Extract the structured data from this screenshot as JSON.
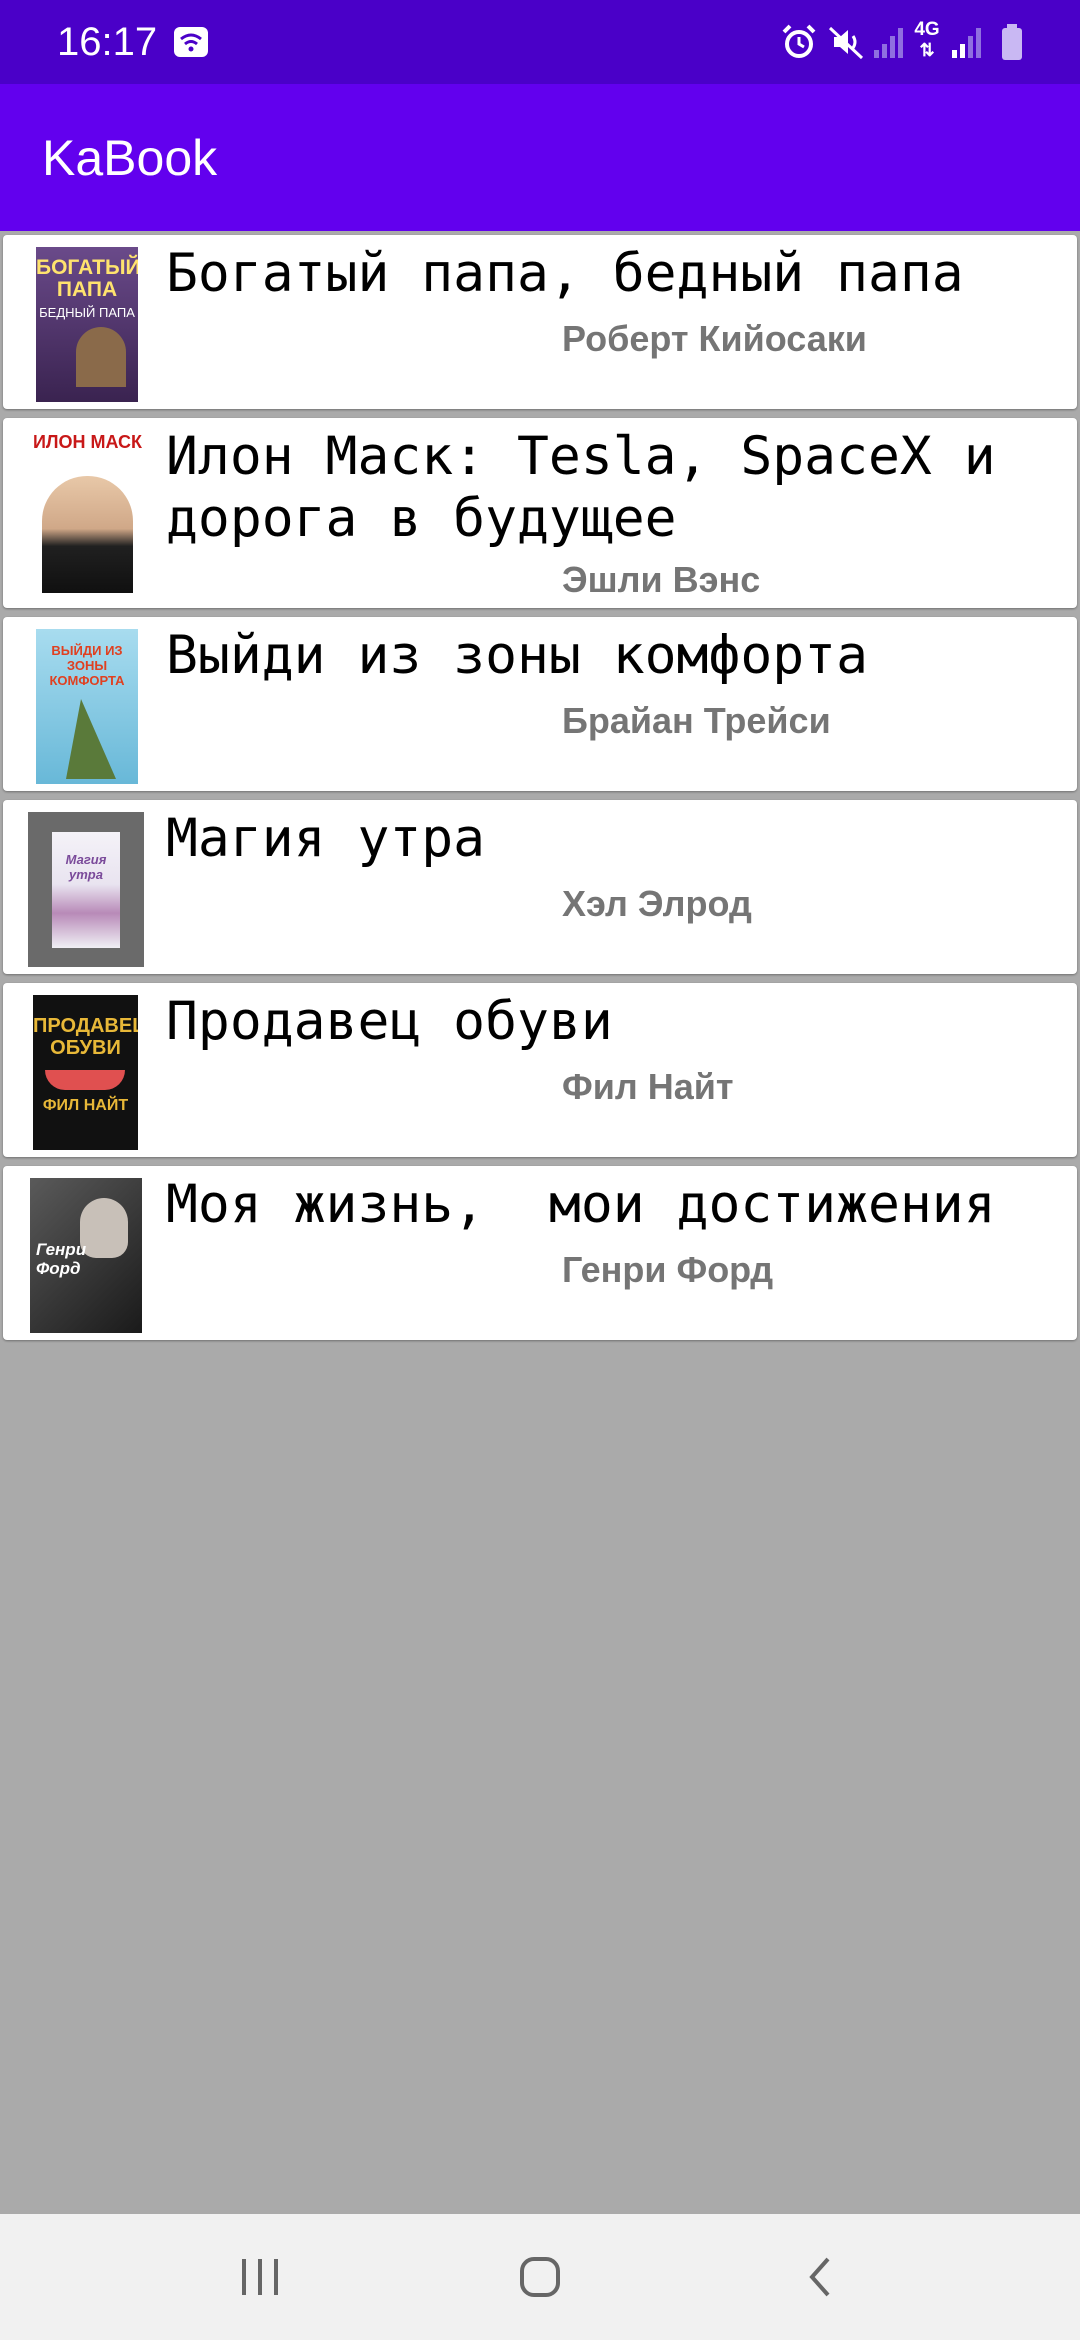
{
  "status_bar": {
    "time": "16:17",
    "network_label": "4G",
    "icons": [
      "wifi-icon",
      "alarm-icon",
      "mute-icon",
      "signal-icon",
      "4g-icon",
      "signal-icon",
      "battery-icon"
    ]
  },
  "app_bar": {
    "title": "KaBook",
    "color": "#6200ee"
  },
  "books": [
    {
      "title": "Богатый папа, бедный папа",
      "author": "Роберт Кийосаки",
      "cover": {
        "top_text": "БОГАТЫЙ ПАПА",
        "bottom_text": "БЕДНЫЙ ПАПА",
        "color": "#5c3a7a"
      }
    },
    {
      "title": "Илон Маск: Tesla, SpaceX и дорога в будущее",
      "author": "Эшли Вэнс",
      "cover": {
        "top_text": "ИЛОН МАСК",
        "color": "#ffffff"
      }
    },
    {
      "title": "Выйди из зоны комфорта",
      "author": "Брайан Трейси",
      "cover": {
        "top_text": "ВЫЙДИ ИЗ ЗОНЫ КОМФОРТА",
        "color": "#7cc4e0"
      }
    },
    {
      "title": "Магия утра",
      "author": "Хэл Элрод",
      "cover": {
        "top_text": "Магия утра",
        "color": "#6a6a6a"
      }
    },
    {
      "title": "Продавец обуви",
      "author": "Фил Найт",
      "cover": {
        "top_text": "ПРОДАВЕЦ ОБУВИ",
        "bottom_text": "ФИЛ НАЙТ",
        "color": "#111111"
      }
    },
    {
      "title": "Моя жизнь,  мои достижения",
      "author": "Генри Форд",
      "cover": {
        "top_text": "Генри Форд",
        "color": "#3a3a3a"
      }
    }
  ],
  "nav_bar": {
    "buttons": [
      "recent-apps-icon",
      "home-icon",
      "back-icon"
    ]
  }
}
